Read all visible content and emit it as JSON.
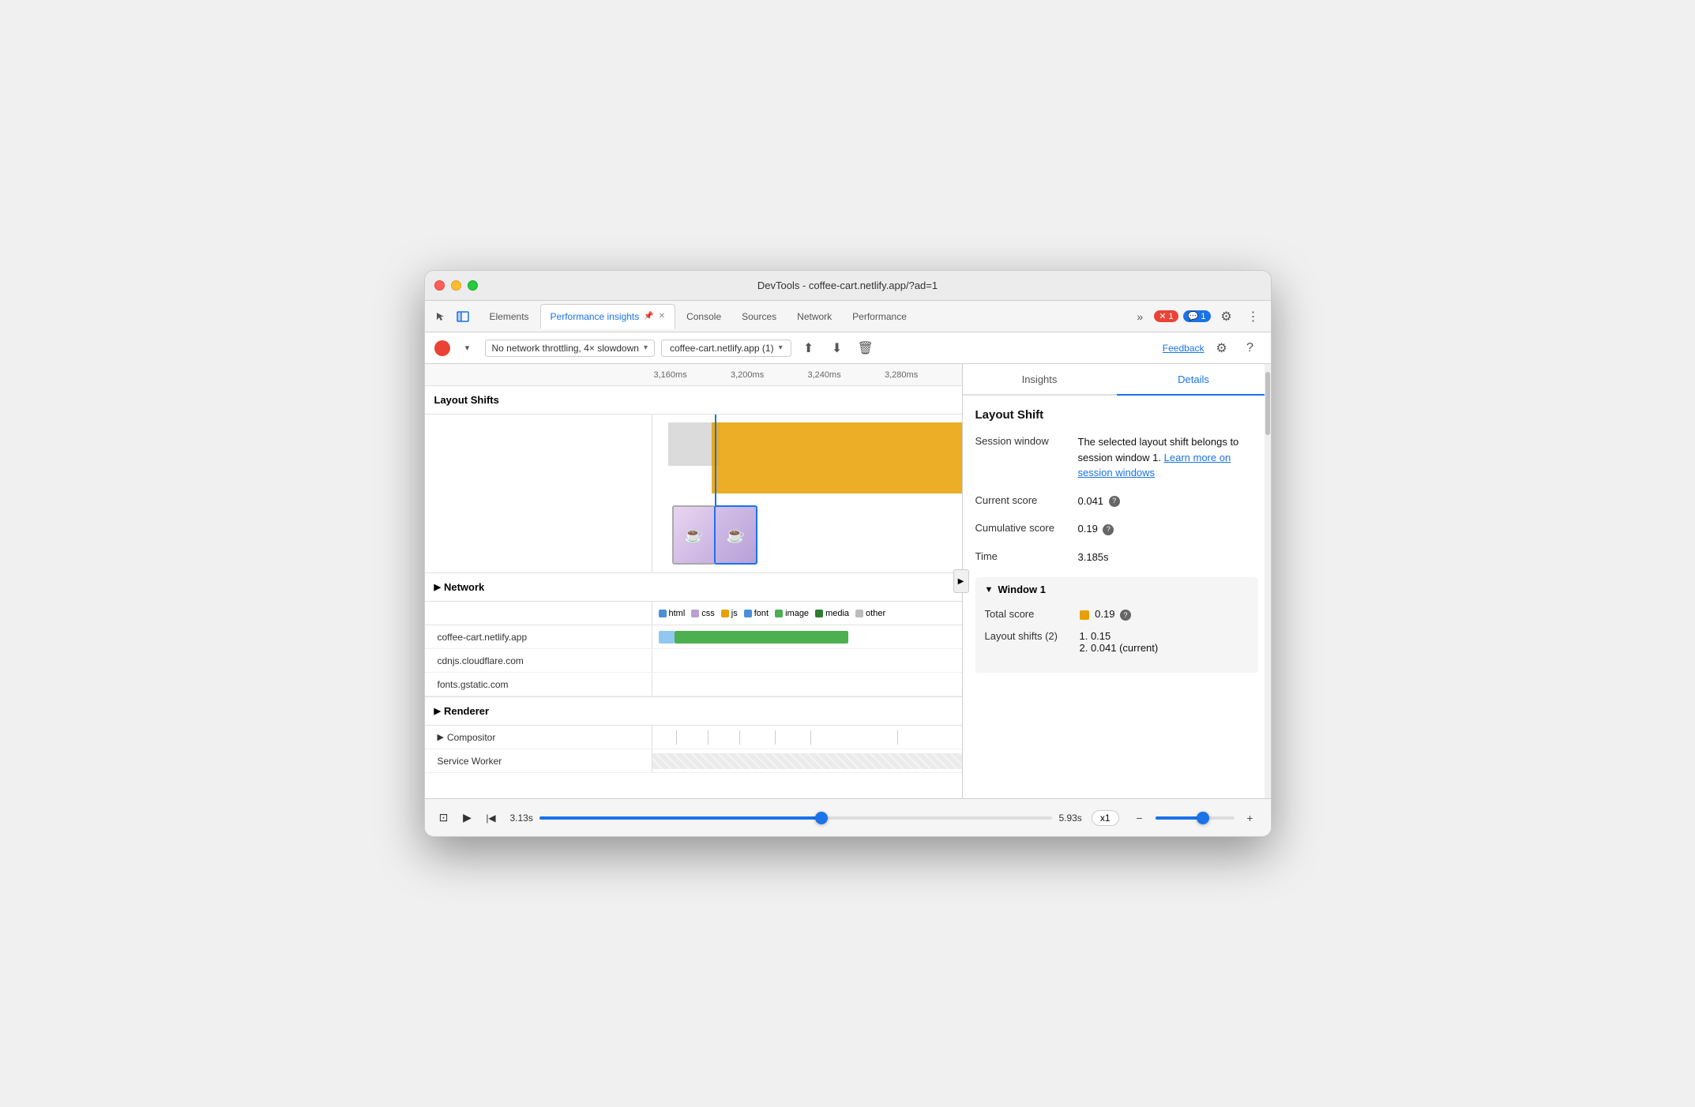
{
  "window": {
    "title": "DevTools - coffee-cart.netlify.app/?ad=1"
  },
  "tabs": {
    "items": [
      {
        "label": "Elements",
        "active": false
      },
      {
        "label": "Performance insights",
        "active": true,
        "pinned": true
      },
      {
        "label": "Console",
        "active": false
      },
      {
        "label": "Sources",
        "active": false
      },
      {
        "label": "Network",
        "active": false
      },
      {
        "label": "Performance",
        "active": false
      }
    ],
    "more_label": "»",
    "error_count": "1",
    "msg_count": "1"
  },
  "toolbar": {
    "throttle_label": "No network throttling, 4× slowdown",
    "url_label": "coffee-cart.netlify.app (1)",
    "feedback_label": "Feedback",
    "caret_label": "▾"
  },
  "timeline": {
    "ticks": [
      "3,160ms",
      "3,200ms",
      "3,240ms",
      "3,280ms"
    ]
  },
  "sections": {
    "layout_shifts": {
      "label": "Layout Shifts"
    },
    "network": {
      "label": "Network",
      "legend": [
        {
          "color": "#4a90d9",
          "label": "html"
        },
        {
          "color": "#b8a0d0",
          "label": "css"
        },
        {
          "color": "#e8a000",
          "label": "js"
        },
        {
          "color": "#4a90d9",
          "label": "font"
        },
        {
          "color": "#4caf50",
          "label": "image"
        },
        {
          "color": "#2e7d32",
          "label": "media"
        },
        {
          "color": "#bdbdbd",
          "label": "other"
        }
      ],
      "rows": [
        {
          "label": "coffee-cart.netlify.app"
        },
        {
          "label": "cdnjs.cloudflare.com"
        },
        {
          "label": "fonts.gstatic.com"
        }
      ]
    },
    "renderer": {
      "label": "Renderer"
    },
    "compositor": {
      "label": "Compositor"
    },
    "service_worker": {
      "label": "Service Worker"
    }
  },
  "bottom_bar": {
    "start_time": "3.13s",
    "end_time": "5.93s",
    "playback_speed": "x1",
    "play_label": "▶",
    "skip_start_label": "|◀",
    "screenshot_label": "⊡",
    "zoom_in_label": "+",
    "zoom_out_label": "−"
  },
  "right_panel": {
    "tabs": [
      {
        "label": "Insights",
        "active": false
      },
      {
        "label": "Details",
        "active": true
      }
    ],
    "details": {
      "section_title": "Layout Shift",
      "rows": [
        {
          "label": "Session window",
          "value": "The selected layout shift belongs to session window 1.",
          "link_text": "Learn more on session windows",
          "link_href": "#"
        },
        {
          "label": "Current score",
          "value": "0.041",
          "has_help": true
        },
        {
          "label": "Cumulative score",
          "value": "0.19",
          "has_help": true
        },
        {
          "label": "Time",
          "value": "3.185s"
        }
      ],
      "window_section": {
        "title": "Window 1",
        "total_score_label": "Total score",
        "total_score_value": "0.19",
        "has_help": true,
        "layout_shifts_label": "Layout shifts (2)",
        "shifts": [
          "1. 0.15",
          "2. 0.041 (current)"
        ]
      }
    }
  }
}
